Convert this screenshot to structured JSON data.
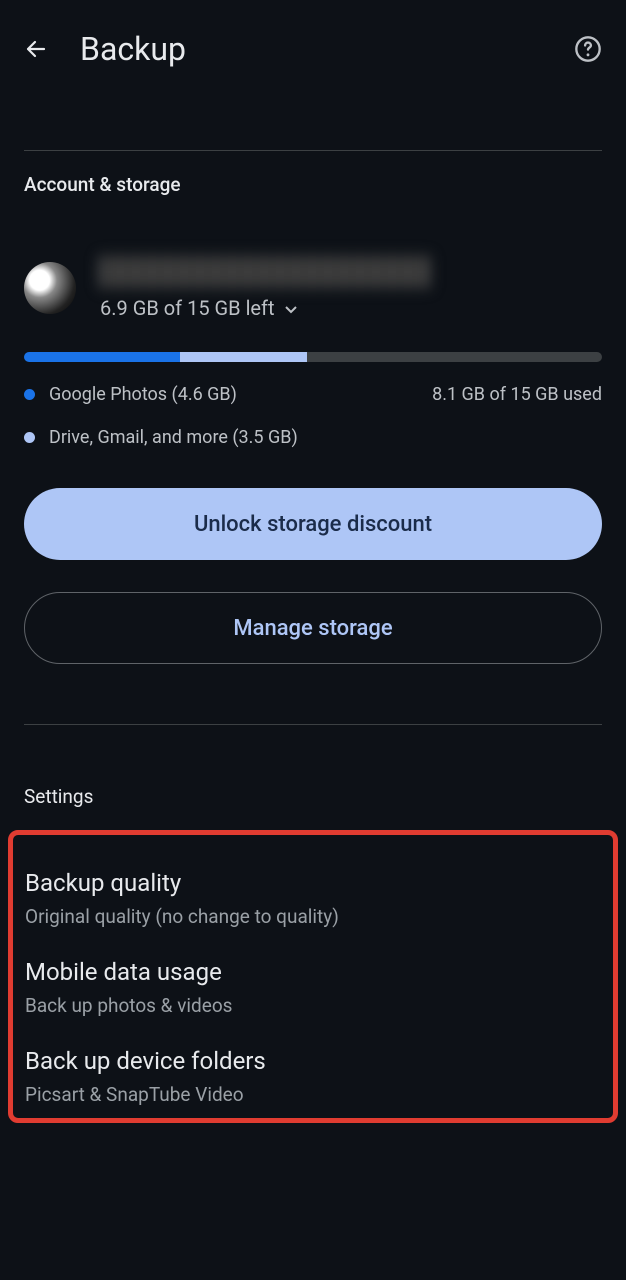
{
  "header": {
    "title": "Backup"
  },
  "account_section": {
    "header": "Account & storage",
    "storage_left": "6.9 GB of 15 GB left",
    "legend_photos": "Google Photos (4.6 GB)",
    "legend_drive": "Drive, Gmail, and more (3.5 GB)",
    "used_total": "8.1 GB of 15 GB used",
    "unlock_btn": "Unlock storage discount",
    "manage_btn": "Manage storage"
  },
  "settings_section": {
    "header": "Settings",
    "items": [
      {
        "title": "Backup quality",
        "sub": "Original quality (no change to quality)"
      },
      {
        "title": "Mobile data usage",
        "sub": "Back up photos & videos"
      },
      {
        "title": "Back up device folders",
        "sub": "Picsart & SnapTube Video"
      }
    ]
  }
}
